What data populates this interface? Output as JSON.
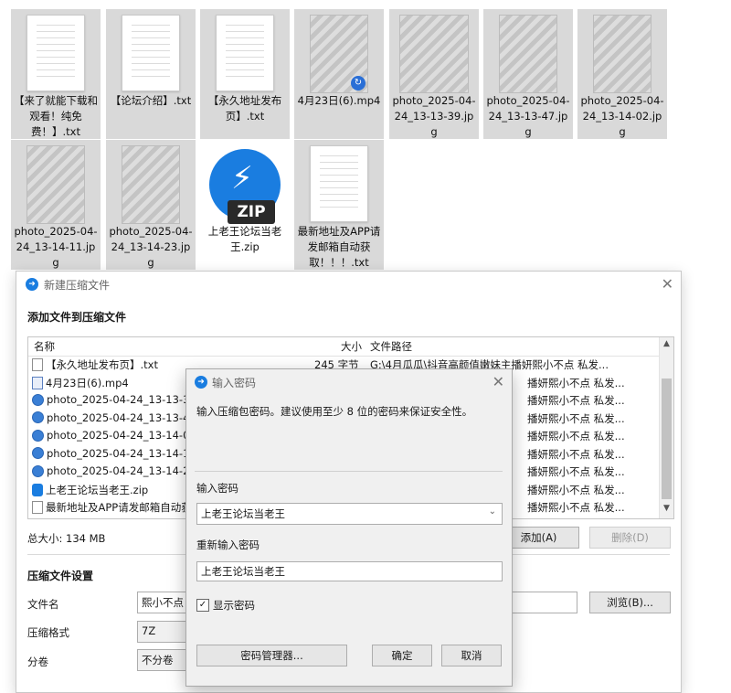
{
  "files": [
    {
      "label": "【来了就能下载和观看！纯免费！】.txt",
      "kind": "txt",
      "icon": "text-file-icon"
    },
    {
      "label": "【论坛介绍】.txt",
      "kind": "txt",
      "icon": "text-file-icon"
    },
    {
      "label": "【永久地址发布页】.txt",
      "kind": "txt",
      "icon": "text-file-icon"
    },
    {
      "label": "4月23日(6).mp4",
      "kind": "mp4",
      "icon": "video-thumbnail"
    },
    {
      "label": "photo_2025-04-24_13-13-39.jpg",
      "kind": "jpg",
      "icon": "photo-thumbnail"
    },
    {
      "label": "photo_2025-04-24_13-13-47.jpg",
      "kind": "jpg",
      "icon": "photo-thumbnail"
    },
    {
      "label": "photo_2025-04-24_13-14-02.jpg",
      "kind": "jpg",
      "icon": "photo-thumbnail"
    },
    {
      "label": "photo_2025-04-24_13-14-11.jpg",
      "kind": "jpg",
      "icon": "photo-thumbnail"
    },
    {
      "label": "photo_2025-04-24_13-14-23.jpg",
      "kind": "jpg",
      "icon": "photo-thumbnail"
    },
    {
      "label": "上老王论坛当老王.zip",
      "kind": "zip",
      "icon": "zip-archive-icon",
      "badge": "ZIP"
    },
    {
      "label": "最新地址及APP请发邮箱自动获取！！！.txt",
      "kind": "txt",
      "icon": "text-file-icon"
    }
  ],
  "dialog": {
    "title": "新建压缩文件",
    "section_add": "添加文件到压缩文件",
    "columns": {
      "name": "名称",
      "size": "大小",
      "path": "文件路径"
    },
    "rows": [
      {
        "name": "【永久地址发布页】.txt",
        "size": "245 字节",
        "path": "G:\\4月瓜瓜\\抖音高颜值嫩妹主播妍熙小不点 私发...",
        "type": "txt"
      },
      {
        "name": "4月23日(6).mp4",
        "size": "",
        "path": "播妍熙小不点 私发...",
        "type": "mp4"
      },
      {
        "name": "photo_2025-04-24_13-13-39.",
        "size": "",
        "path": "播妍熙小不点 私发...",
        "type": "jpg"
      },
      {
        "name": "photo_2025-04-24_13-13-47.",
        "size": "",
        "path": "播妍熙小不点 私发...",
        "type": "jpg"
      },
      {
        "name": "photo_2025-04-24_13-14-02.",
        "size": "",
        "path": "播妍熙小不点 私发...",
        "type": "jpg"
      },
      {
        "name": "photo_2025-04-24_13-14-11.",
        "size": "",
        "path": "播妍熙小不点 私发...",
        "type": "jpg"
      },
      {
        "name": "photo_2025-04-24_13-14-23.",
        "size": "",
        "path": "播妍熙小不点 私发...",
        "type": "jpg"
      },
      {
        "name": "上老王论坛当老王.zip",
        "size": "",
        "path": "播妍熙小不点 私发...",
        "type": "zip"
      },
      {
        "name": "最新地址及APP请发邮箱自动获",
        "size": "",
        "path": "播妍熙小不点 私发...",
        "type": "txt"
      }
    ],
    "total": "总大小: 134 MB",
    "add_btn": "添加(A)",
    "delete_btn": "删除(D)",
    "section_settings": "压缩文件设置",
    "filename_label": "文件名",
    "filename_value": "熙小不点 私",
    "browse_btn": "浏览(B)...",
    "format_label": "压缩格式",
    "format_value": "7Z",
    "split_label": "分卷",
    "split_value": "不分卷"
  },
  "password": {
    "title": "输入密码",
    "message": "输入压缩包密码。建议使用至少 8 位的密码来保证安全性。",
    "enter_label": "输入密码",
    "enter_value": "上老王论坛当老王",
    "reenter_label": "重新输入密码",
    "reenter_value": "上老王论坛当老王",
    "show_label": "显示密码",
    "show_checked": "☑",
    "manager_btn": "密码管理器...",
    "ok_btn": "确定",
    "cancel_btn": "取消"
  }
}
